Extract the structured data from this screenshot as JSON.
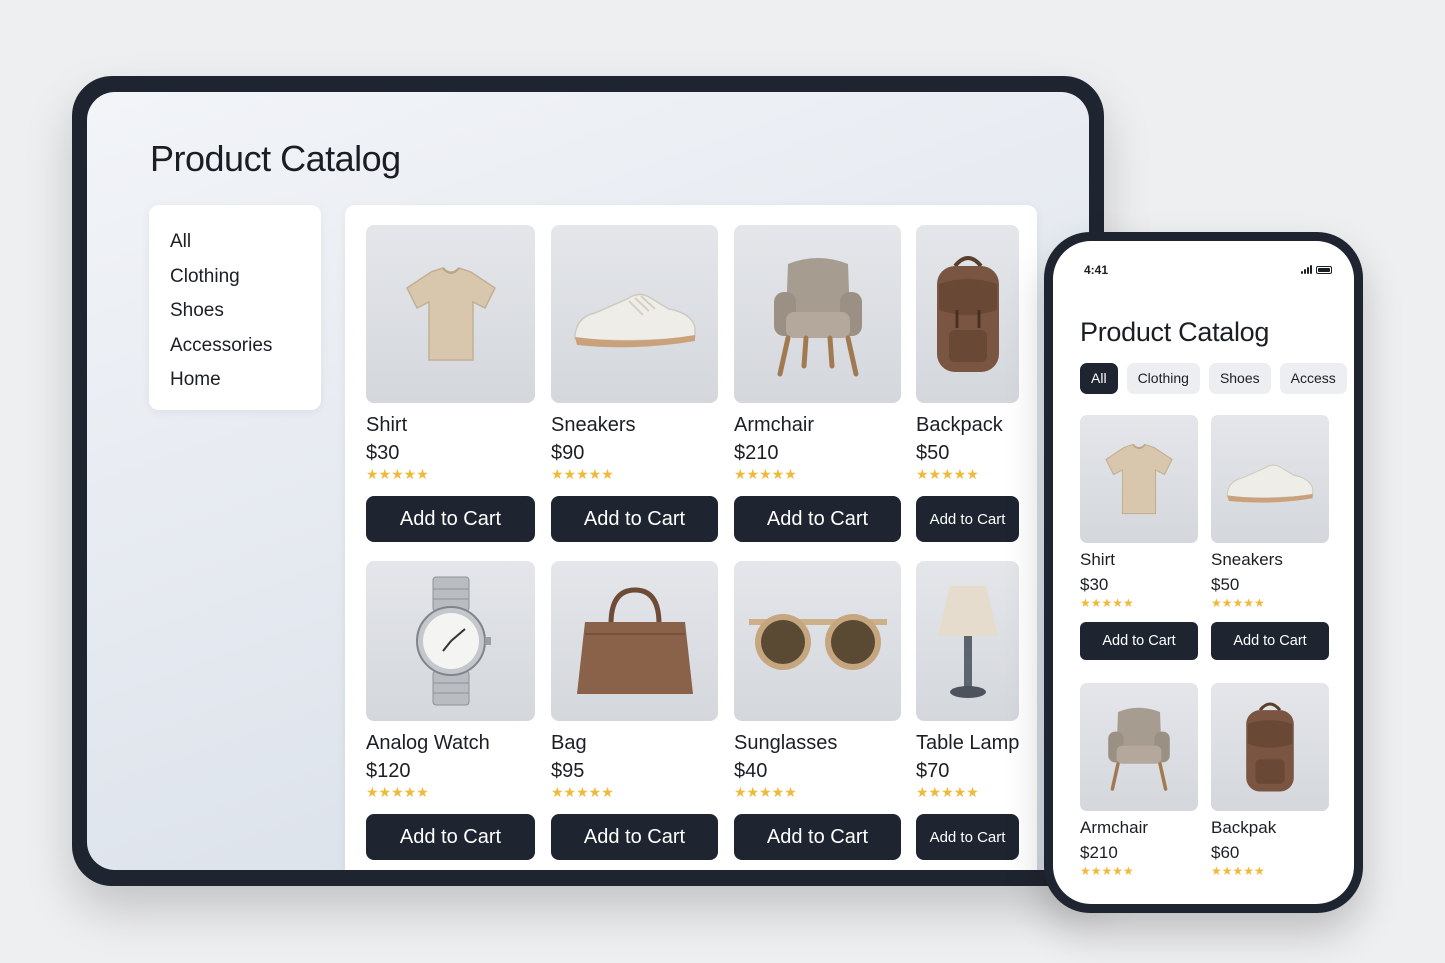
{
  "tablet": {
    "title": "Product Catalog",
    "categories": [
      "All",
      "Clothing",
      "Shoes",
      "Accessories",
      "Home"
    ],
    "products": [
      {
        "name": "Shirt",
        "price": "$30",
        "stars": "★★★★★",
        "button": "Add to Cart",
        "icon": "tshirt-icon"
      },
      {
        "name": "Sneakers",
        "price": "$90",
        "stars": "★★★★★",
        "button": "Add to Cart",
        "icon": "sneaker-icon"
      },
      {
        "name": "Armchair",
        "price": "$210",
        "stars": "★★★★★",
        "button": "Add to Cart",
        "icon": "armchair-icon"
      },
      {
        "name": "Backpack",
        "price": "$50",
        "stars": "★★★★★",
        "button": "Add to Cart",
        "icon": "backpack-icon"
      },
      {
        "name": "Analog Watch",
        "price": "$120",
        "stars": "★★★★★",
        "button": "Add to Cart",
        "icon": "watch-icon"
      },
      {
        "name": "Bag",
        "price": "$95",
        "stars": "★★★★★",
        "button": "Add to Cart",
        "icon": "handbag-icon"
      },
      {
        "name": "Sunglasses",
        "price": "$40",
        "stars": "★★★★★",
        "button": "Add to Cart",
        "icon": "sunglasses-icon"
      },
      {
        "name": "Table Lamp",
        "price": "$70",
        "stars": "★★★★★",
        "button": "Add to Cart",
        "icon": "lamp-icon"
      }
    ]
  },
  "phone": {
    "status_time": "4:41",
    "title": "Product Catalog",
    "chips": [
      "All",
      "Clothing",
      "Shoes",
      "Access"
    ],
    "products": [
      {
        "name": "Shirt",
        "price": "$30",
        "stars": "★★★★★",
        "button": "Add to Cart",
        "icon": "tshirt-icon"
      },
      {
        "name": "Sneakers",
        "price": "$50",
        "stars": "★★★★★",
        "button": "Add to Cart",
        "icon": "sneaker-icon"
      },
      {
        "name": "Armchair",
        "price": "$210",
        "stars": "★★★★★",
        "icon": "armchair-icon"
      },
      {
        "name": "Backpak",
        "price": "$60",
        "stars": "★★★★★",
        "icon": "backpack-icon"
      }
    ]
  },
  "colors": {
    "dark": "#1f2530",
    "star": "#f0b93a",
    "background": "#eeeff1"
  }
}
